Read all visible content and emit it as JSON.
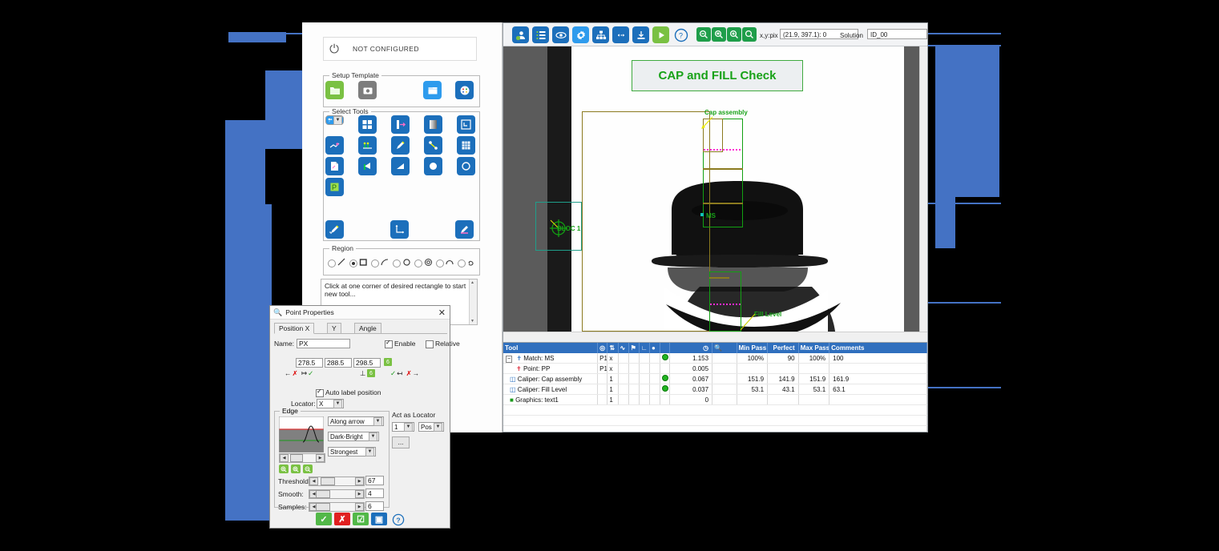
{
  "status": {
    "label": "NOT CONFIGURED",
    "icon": "power-icon"
  },
  "groups": {
    "setup_template": "Setup Template",
    "select_tools": "Select Tools",
    "region": "Region"
  },
  "log": {
    "message": "Click at one corner of desired rectangle to start new tool..."
  },
  "toolbar": {
    "icons": [
      "user-add-icon",
      "list-icon",
      "eye-icon",
      "gear-icon",
      "hierarchy-icon",
      "connect-icon",
      "download-icon",
      "run-play-icon",
      "help-icon"
    ],
    "zoom_icons": [
      "zoom-out-icon",
      "zoom-fit-icon",
      "zoom-in-icon",
      "zoom-region-icon"
    ],
    "coord_label": "x,y:pix",
    "coord_value": "(21.9, 397.1): 0",
    "solution_label": "Solution",
    "solution_value": "ID_00"
  },
  "viewport": {
    "banner_title": "CAP and FILL Check",
    "annotations": [
      {
        "name": "cap-assembly-label",
        "text": "Cap assembly"
      },
      {
        "name": "ms-label",
        "text": "MS"
      },
      {
        "name": "bloc-label",
        "text": "BLOC 1"
      },
      {
        "name": "fill-level-label",
        "text": "Fill Level"
      }
    ]
  },
  "results_table": {
    "columns": [
      "Tool",
      "c1",
      "c2",
      "c3",
      "c4",
      "c5",
      "c6",
      "score",
      "search",
      "Min Pass",
      "Perfect",
      "Max Pass",
      "Comments"
    ],
    "header_icons": [
      "target-icon",
      "scale-icon",
      "wave-icon",
      "flag-icon",
      "angle-icon",
      "traffic-icon",
      "clock-icon",
      "magnifier-icon"
    ],
    "rows": [
      {
        "tool": "Match: MS",
        "icon": "match-icon",
        "c1": "P1",
        "c2": "x",
        "c5": "dot",
        "score": "1.153",
        "min": "100%",
        "perfect": "90",
        "max": "100%",
        "extra": "100",
        "comments": ""
      },
      {
        "tool": "Point: PP",
        "icon": "point-icon",
        "c1": "P1",
        "c2": "x",
        "c5": "",
        "score": "0.005",
        "min": "",
        "perfect": "",
        "max": "",
        "extra": "",
        "comments": ""
      },
      {
        "tool": "Caliper: Cap assembly",
        "icon": "caliper-icon",
        "c1": "",
        "c2": "1",
        "c5": "dot",
        "score": "0.067",
        "min": "151.9",
        "perfect": "141.9",
        "max": "151.9",
        "extra": "161.9",
        "comments": ""
      },
      {
        "tool": "Caliper: Fill Level",
        "icon": "caliper-icon",
        "c1": "",
        "c2": "1",
        "c5": "dot",
        "score": "0.037",
        "min": "53.1",
        "perfect": "43.1",
        "max": "53.1",
        "extra": "63.1",
        "comments": ""
      },
      {
        "tool": "Graphics: text1",
        "icon": "graphics-icon",
        "c1": "",
        "c2": "1",
        "c5": "",
        "score": "0",
        "min": "",
        "perfect": "",
        "max": "",
        "extra": "",
        "comments": ""
      }
    ]
  },
  "dialog": {
    "title": "Point Properties",
    "title_icon": "magnifier-icon",
    "close_label": "✕",
    "tabs": [
      {
        "label": "Position  X",
        "active": true
      },
      {
        "label": "Y",
        "active": false
      },
      {
        "label": "Angle",
        "active": false
      }
    ],
    "name_label": "Name:",
    "name_value": "PX",
    "enable_label": "Enable",
    "enable_checked": true,
    "relative_label": "Relative",
    "relative_checked": false,
    "values": [
      "278.5",
      "288.5",
      "298.5"
    ],
    "badge_right": "6",
    "badge_mid": "6",
    "auto_label_text": "Auto label position",
    "auto_label_checked": true,
    "locator_label": "Locator:",
    "locator_value": "X",
    "edge_group": "Edge",
    "edge_direction": "Along arrow",
    "edge_polarity": "Dark-Bright",
    "edge_strength": "Strongest",
    "threshold_label": "Threshold:",
    "threshold_value": "67",
    "smooth_label": "Smooth:",
    "smooth_value": "4",
    "samples_label": "Samples:",
    "samples_value": "6",
    "act_as_locator_label": "Act as Locator",
    "locator_num": "1",
    "locator_mode": "Pos",
    "locator_btn": "...",
    "buttons": [
      "ok-check-button",
      "cancel-x-button",
      "apply-check-button",
      "contrast-button",
      "help-button"
    ]
  },
  "colors": {
    "accent_blue": "#4472c4",
    "tool_blue": "#1c6fbb",
    "green": "#7ac143",
    "banner_green": "#18a218",
    "header_blue": "#2f6fbe"
  }
}
